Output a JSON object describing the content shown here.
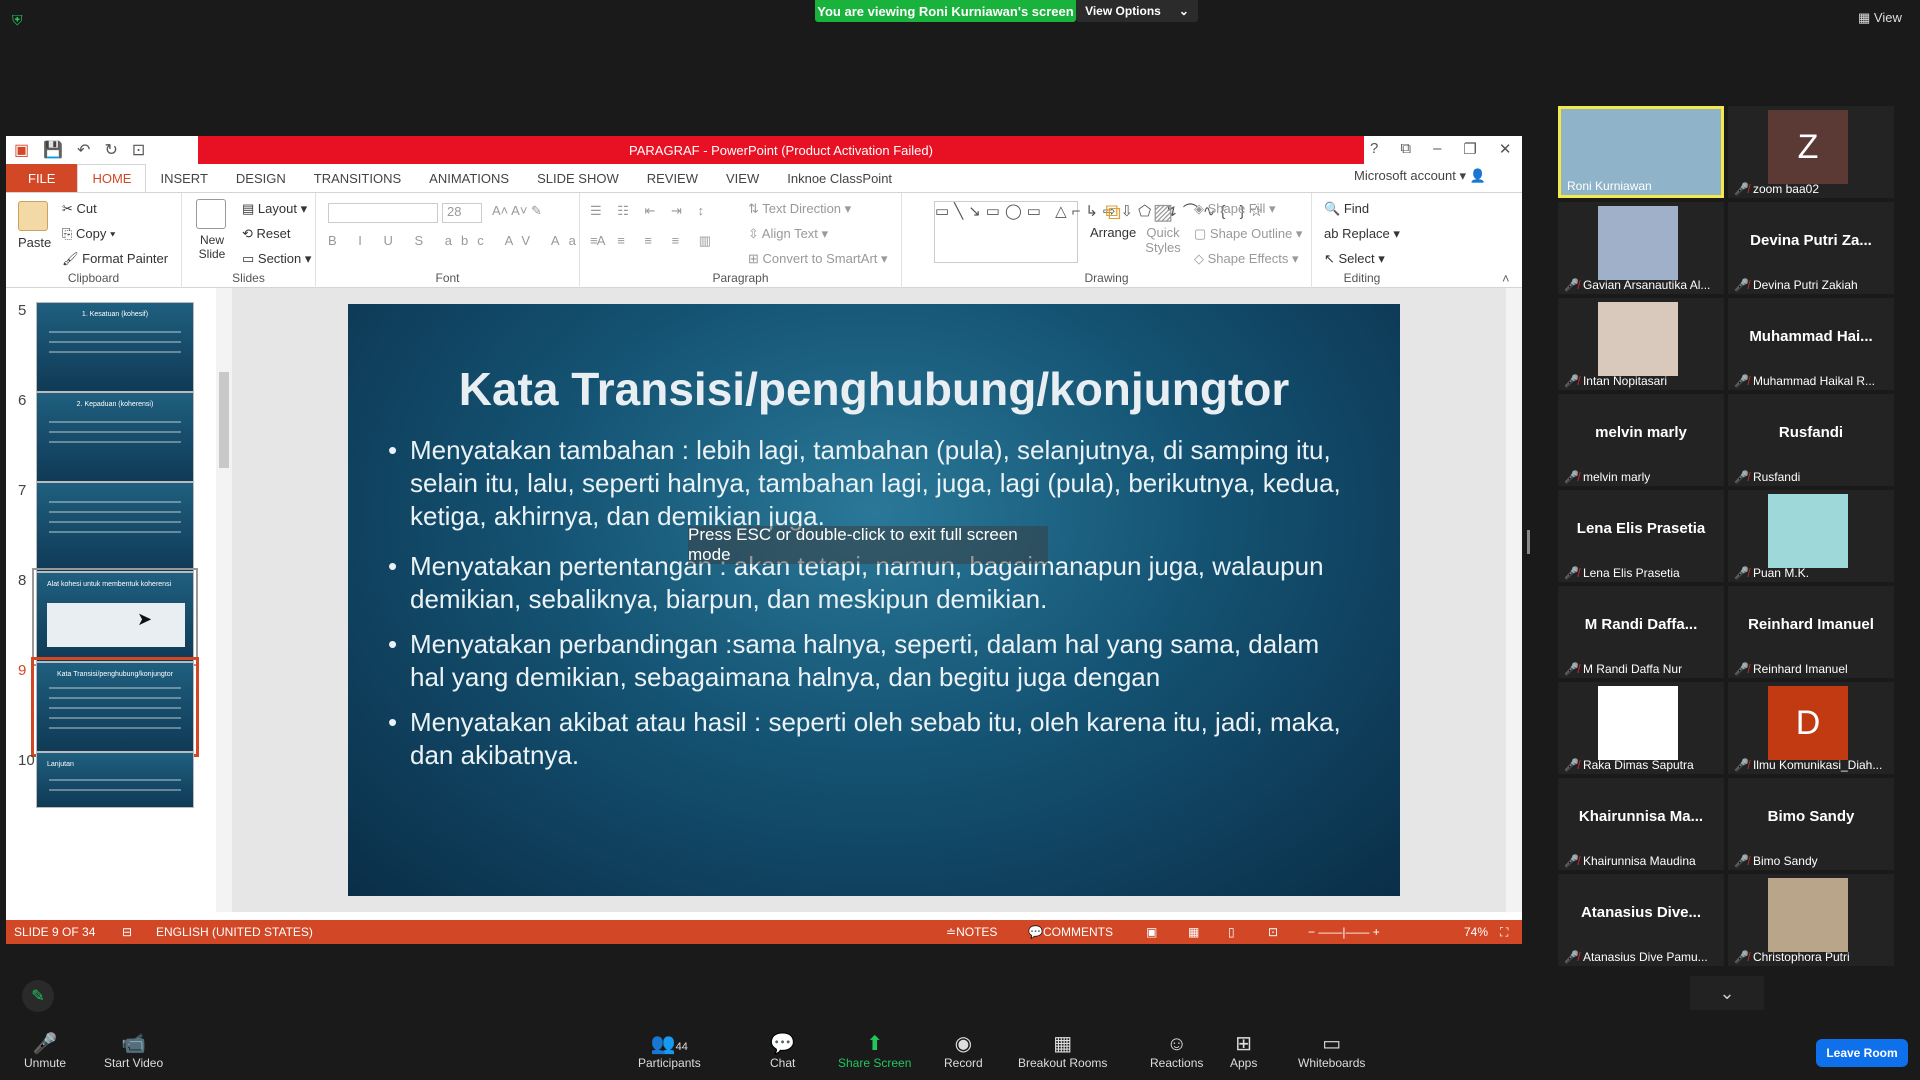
{
  "zoom": {
    "banner": "You are viewing Roni Kurniawan's screen",
    "view_options": "View Options",
    "view": "View",
    "esc_toast": "Press ESC or double-click to exit full screen mode",
    "leave": "Leave Room",
    "toolbar": [
      {
        "label": "Unmute",
        "icon": "mic-off-icon",
        "glyph": "🎤"
      },
      {
        "label": "Start Video",
        "icon": "video-off-icon",
        "glyph": "📹"
      },
      {
        "label": "Participants",
        "icon": "participants-icon",
        "glyph": "👥",
        "count": "44"
      },
      {
        "label": "Chat",
        "icon": "chat-icon",
        "glyph": "💬"
      },
      {
        "label": "Share Screen",
        "icon": "share-screen-icon",
        "glyph": "⬆"
      },
      {
        "label": "Record",
        "icon": "record-icon",
        "glyph": "◉"
      },
      {
        "label": "Breakout Rooms",
        "icon": "breakout-rooms-icon",
        "glyph": "▦"
      },
      {
        "label": "Reactions",
        "icon": "reactions-icon",
        "glyph": "☺"
      },
      {
        "label": "Apps",
        "icon": "apps-icon",
        "glyph": "⊞"
      },
      {
        "label": "Whiteboards",
        "icon": "whiteboard-icon",
        "glyph": "▭"
      }
    ],
    "participants": [
      {
        "name": "Roni Kurniawan",
        "big": "",
        "avatar": "video",
        "color": "#8fb3c9"
      },
      {
        "name": "zoom baa02",
        "big": "",
        "avatar": "Z",
        "color": "#5b3a36"
      },
      {
        "name": "Gavian Arsanautika Al...",
        "big": "",
        "avatar": "img",
        "color": "#9fb0c8"
      },
      {
        "name": "Devina Putri Zakiah",
        "big": "Devina Putri Za...",
        "avatar": "",
        "color": ""
      },
      {
        "name": "Intan Nopitasari",
        "big": "",
        "avatar": "img",
        "color": "#d9c9bc"
      },
      {
        "name": "Muhammad Haikal R...",
        "big": "Muhammad Hai...",
        "avatar": "",
        "color": ""
      },
      {
        "name": "melvin marly",
        "big": "melvin marly",
        "avatar": "",
        "color": ""
      },
      {
        "name": "Rusfandi",
        "big": "Rusfandi",
        "avatar": "",
        "color": ""
      },
      {
        "name": "Lena Elis Prasetia",
        "big": "Lena Elis Prasetia",
        "avatar": "",
        "color": ""
      },
      {
        "name": "Puan M.K.",
        "big": "",
        "avatar": "img",
        "color": "#9fd8d8"
      },
      {
        "name": "M Randi Daffa Nur",
        "big": "M Randi Daffa...",
        "avatar": "",
        "color": ""
      },
      {
        "name": "Reinhard Imanuel",
        "big": "Reinhard Imanuel",
        "avatar": "",
        "color": ""
      },
      {
        "name": "Raka Dimas Saputra",
        "big": "",
        "avatar": "img",
        "color": "#ffffff"
      },
      {
        "name": "Ilmu Komunikasi_Diah...",
        "big": "",
        "avatar": "D",
        "color": "#c23a12"
      },
      {
        "name": "Khairunnisa Maudina",
        "big": "Khairunnisa Ma...",
        "avatar": "",
        "color": ""
      },
      {
        "name": "Bimo Sandy",
        "big": "Bimo Sandy",
        "avatar": "",
        "color": ""
      },
      {
        "name": "Atanasius Dive Pamu...",
        "big": "Atanasius Dive...",
        "avatar": "",
        "color": ""
      },
      {
        "name": "Christophora Putri",
        "big": "",
        "avatar": "img",
        "color": "#b9a58a"
      }
    ]
  },
  "ppt": {
    "title": "PARAGRAF - PowerPoint (Product Activation Failed)",
    "tabs": [
      "FILE",
      "HOME",
      "INSERT",
      "DESIGN",
      "TRANSITIONS",
      "ANIMATIONS",
      "SLIDE SHOW",
      "REVIEW",
      "VIEW",
      "Inknoe ClassPoint"
    ],
    "account": "Microsoft account",
    "ribbon": {
      "paste": "Paste",
      "cut": "Cut",
      "copy": "Copy",
      "format_painter": "Format Painter",
      "clipboard": "Clipboard",
      "new_slide": "New Slide",
      "layout": "Layout",
      "reset": "Reset",
      "section": "Section",
      "slides": "Slides",
      "font_size": "28",
      "font": "Font",
      "text_direction": "Text Direction",
      "align_text": "Align Text",
      "convert_smartart": "Convert to SmartArt",
      "paragraph": "Paragraph",
      "arrange": "Arrange",
      "quick_styles": "Quick Styles",
      "shape_fill": "Shape Fill",
      "shape_outline": "Shape Outline",
      "shape_effects": "Shape Effects",
      "drawing": "Drawing",
      "find": "Find",
      "replace": "Replace",
      "select": "Select",
      "editing": "Editing"
    },
    "thumbs": [
      {
        "num": "5",
        "title": "1. Kesatuan (kohesif)"
      },
      {
        "num": "6",
        "title": "2. Kepaduan (koherensi)"
      },
      {
        "num": "7",
        "title": ""
      },
      {
        "num": "8",
        "title": "Alat kohesi untuk membentuk koherensi"
      },
      {
        "num": "9",
        "title": "Kata Transisi/penghubung/konjungtor"
      },
      {
        "num": "10",
        "title": "Lanjutan"
      }
    ],
    "slide": {
      "title": "Kata Transisi/penghubung/konjungtor",
      "bullets": [
        "Menyatakan tambahan : lebih lagi, tambahan (pula), selanjutnya, di samping itu, selain itu, lalu, seperti halnya, tambahan lagi, juga, lagi (pula), berikutnya, kedua, ketiga, akhirnya, dan demikian juga.",
        "Menyatakan pertentangan : akan tetapi, namun, bagaimanapun juga, walaupun demikian, sebaliknya, biarpun, dan meskipun demikian.",
        "Menyatakan perbandingan :sama halnya, seperti, dalam hal yang sama, dalam hal yang demikian, sebagaimana halnya, dan begitu juga dengan",
        "Menyatakan akibat atau hasil : seperti oleh sebab itu, oleh karena itu, jadi, maka, dan akibatnya."
      ]
    },
    "status": {
      "slide": "SLIDE 9 OF 34",
      "lang": "ENGLISH (UNITED STATES)",
      "notes": "NOTES",
      "comments": "COMMENTS",
      "zoom": "74%"
    }
  }
}
